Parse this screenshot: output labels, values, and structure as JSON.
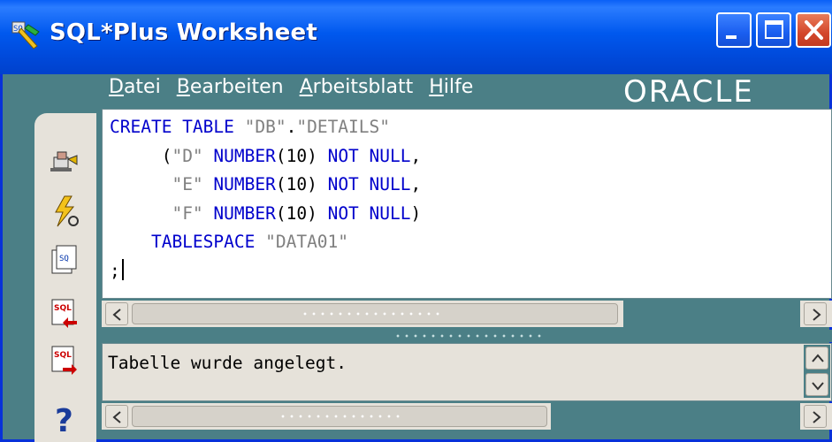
{
  "window": {
    "title": "SQL*Plus Worksheet",
    "brand_color": "#0a5ff2",
    "body_color": "#4b7f86",
    "close_color": "#d3472b"
  },
  "menu": {
    "items": [
      {
        "label": "Datei",
        "mnemonic": "D"
      },
      {
        "label": "Bearbeiten",
        "mnemonic": "B"
      },
      {
        "label": "Arbeitsblatt",
        "mnemonic": "A"
      },
      {
        "label": "Hilfe",
        "mnemonic": "H"
      }
    ],
    "logo": "ORACLE"
  },
  "toolbar": {
    "tools": [
      {
        "icon": "connect-icon"
      },
      {
        "icon": "execute-icon"
      },
      {
        "icon": "command-history-icon"
      },
      {
        "icon": "previous-command-icon"
      },
      {
        "icon": "next-command-icon"
      },
      {
        "icon": "help-icon"
      }
    ]
  },
  "editor": {
    "lines": [
      [
        {
          "t": "CREATE TABLE ",
          "c": "kw"
        },
        {
          "t": "\"DB\"",
          "c": "str"
        },
        {
          "t": ".",
          "c": ""
        },
        {
          "t": "\"DETAILS\"",
          "c": "str"
        }
      ],
      [
        {
          "t": "     (",
          "c": ""
        },
        {
          "t": "\"D\"",
          "c": "str"
        },
        {
          "t": " NUMBER",
          "c": "kw"
        },
        {
          "t": "(10) ",
          "c": ""
        },
        {
          "t": "NOT NULL",
          "c": "kw"
        },
        {
          "t": ",",
          "c": ""
        }
      ],
      [
        {
          "t": "      ",
          "c": ""
        },
        {
          "t": "\"E\"",
          "c": "str"
        },
        {
          "t": " NUMBER",
          "c": "kw"
        },
        {
          "t": "(10) ",
          "c": ""
        },
        {
          "t": "NOT NULL",
          "c": "kw"
        },
        {
          "t": ",",
          "c": ""
        }
      ],
      [
        {
          "t": "      ",
          "c": ""
        },
        {
          "t": "\"F\"",
          "c": "str"
        },
        {
          "t": " NUMBER",
          "c": "kw"
        },
        {
          "t": "(10) ",
          "c": ""
        },
        {
          "t": "NOT NULL",
          "c": "kw"
        },
        {
          "t": ")",
          "c": ""
        }
      ],
      [
        {
          "t": "    TABLESPACE ",
          "c": "kw"
        },
        {
          "t": "\"DATA01\"",
          "c": "str"
        }
      ],
      [
        {
          "t": ";",
          "c": ""
        }
      ]
    ],
    "keyword_color": "#0000cc",
    "string_color": "#808080"
  },
  "output": {
    "text": "Tabelle wurde angelegt."
  }
}
